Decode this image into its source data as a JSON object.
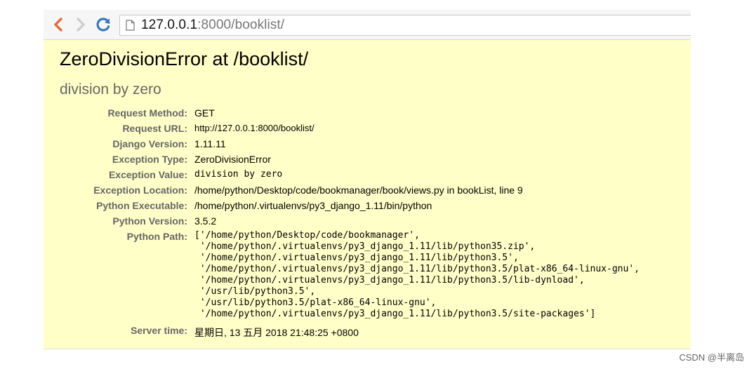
{
  "browser": {
    "url_host": "127.0.0.1",
    "url_rest": ":8000/booklist/"
  },
  "error": {
    "title": "ZeroDivisionError at /booklist/",
    "subtitle": "division by zero"
  },
  "meta": [
    {
      "label": "Request Method:",
      "value": "GET"
    },
    {
      "label": "Request URL:",
      "value": "http://127.0.0.1:8000/booklist/"
    },
    {
      "label": "Django Version:",
      "value": "1.11.11"
    },
    {
      "label": "Exception Type:",
      "value": "ZeroDivisionError"
    },
    {
      "label": "Exception Value:",
      "value": "division by zero"
    },
    {
      "label": "Exception Location:",
      "value": "/home/python/Desktop/code/bookmanager/book/views.py in bookList, line 9"
    },
    {
      "label": "Python Executable:",
      "value": "/home/python/.virtualenvs/py3_django_1.11/bin/python"
    },
    {
      "label": "Python Version:",
      "value": "3.5.2"
    }
  ],
  "python_path": {
    "label": "Python Path:",
    "lines": [
      "['/home/python/Desktop/code/bookmanager',",
      " '/home/python/.virtualenvs/py3_django_1.11/lib/python35.zip',",
      " '/home/python/.virtualenvs/py3_django_1.11/lib/python3.5',",
      " '/home/python/.virtualenvs/py3_django_1.11/lib/python3.5/plat-x86_64-linux-gnu',",
      " '/home/python/.virtualenvs/py3_django_1.11/lib/python3.5/lib-dynload',",
      " '/usr/lib/python3.5',",
      " '/usr/lib/python3.5/plat-x86_64-linux-gnu',",
      " '/home/python/.virtualenvs/py3_django_1.11/lib/python3.5/site-packages']"
    ]
  },
  "server_time": {
    "label": "Server time:",
    "value": "星期日, 13 五月 2018 21:48:25 +0800"
  },
  "watermark": "CSDN @半离岛",
  "colors": {
    "summary_bg": "#ffffc8",
    "back_arrow": "#e06c3c",
    "reload": "#3a78c2"
  }
}
